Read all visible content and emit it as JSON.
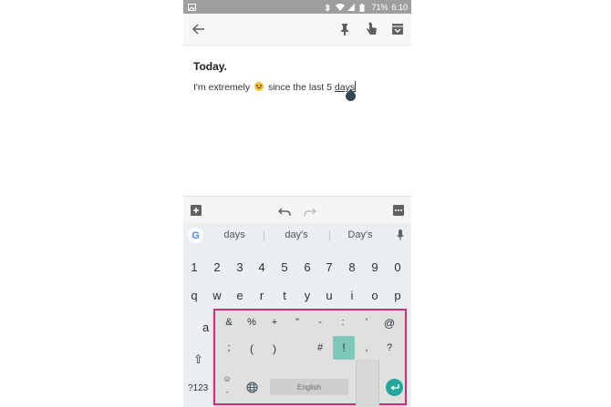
{
  "status_bar": {
    "battery": "71%",
    "time": "6:10"
  },
  "icons": {
    "back": "back-arrow-icon",
    "pin": "pin-icon",
    "reminder": "reminder-hand-icon",
    "archive": "archive-icon",
    "add": "add-box-icon",
    "undo": "undo-icon",
    "redo": "redo-icon",
    "more": "more-icon",
    "mic": "mic-icon",
    "shift": "shift-icon",
    "globe": "globe-icon",
    "enter": "enter-icon"
  },
  "note": {
    "title": "Today.",
    "text_before": "I'm extremely",
    "text_after": "since the last 5",
    "underlined_word": "days"
  },
  "keyboard": {
    "google_logo": "G",
    "suggestions": [
      "days",
      "day's",
      "Day's"
    ],
    "row_numbers": [
      "1",
      "2",
      "3",
      "4",
      "5",
      "6",
      "7",
      "8",
      "9",
      "0"
    ],
    "row_qwerty": [
      "q",
      "w",
      "e",
      "r",
      "t",
      "y",
      "u",
      "i",
      "o",
      "p"
    ],
    "left_keys": {
      "a": "a",
      "shift_symbol": "⇧",
      "symbols": "?123"
    },
    "popup": {
      "row1": [
        "&",
        "%",
        "+",
        "\"",
        "-",
        ":",
        "'",
        "@"
      ],
      "row2": [
        ";",
        "(",
        ")",
        "#",
        "!",
        ",",
        "?"
      ],
      "emoji_top": "☺",
      "emoji_bottom": ",",
      "space_label": "English"
    }
  },
  "colors": {
    "accent_teal": "#26a69a",
    "highlight": "#d02f7c"
  }
}
